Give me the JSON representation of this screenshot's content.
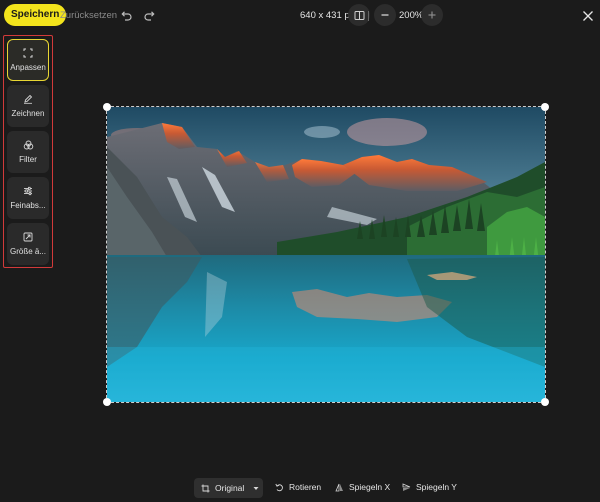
{
  "toolbar": {
    "save_label": "Speichern",
    "reset_label": "Zurücksetzen",
    "dimensions": "640 x 431 px",
    "zoom_level": "200%"
  },
  "sidebar": {
    "tools": [
      {
        "label": "Anpassen",
        "icon": "crop-icon",
        "active": true
      },
      {
        "label": "Zeichnen",
        "icon": "pencil-icon",
        "active": false
      },
      {
        "label": "Filter",
        "icon": "filter-icon",
        "active": false
      },
      {
        "label": "Feinabs...",
        "icon": "sliders-icon",
        "active": false
      },
      {
        "label": "Größe ä...",
        "icon": "resize-icon",
        "active": false
      }
    ]
  },
  "bottombar": {
    "aspect_label": "Original",
    "rotate_label": "Rotieren",
    "flip_x_label": "Spiegeln X",
    "flip_y_label": "Spiegeln Y"
  },
  "colors": {
    "accent": "#f3e41c",
    "highlight_border": "#d23a3a",
    "background": "#1b1b1b"
  }
}
